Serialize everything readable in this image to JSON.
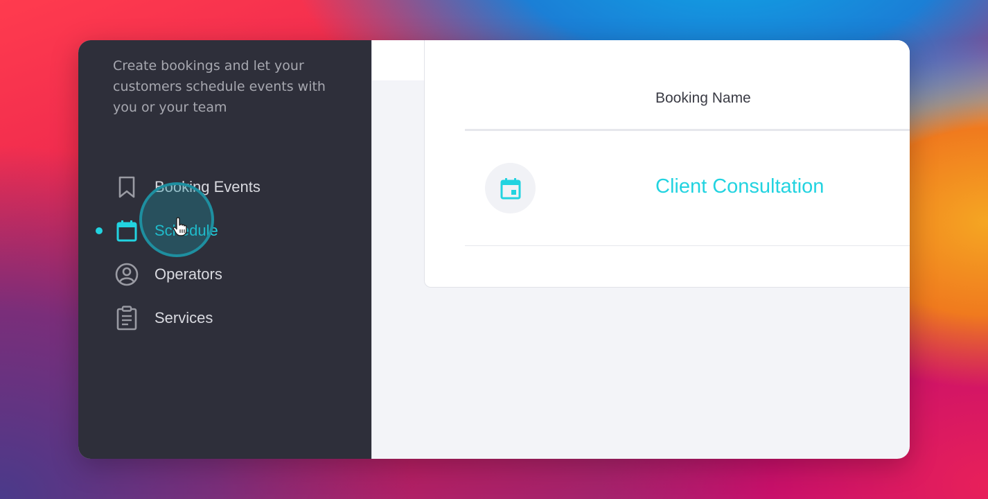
{
  "sidebar": {
    "description": "Create bookings and let your customers schedule events with you or your team",
    "items": [
      {
        "label": "Booking Events",
        "icon": "bookmark-icon",
        "active": false
      },
      {
        "label": "Schedule",
        "icon": "calendar-icon",
        "active": true
      },
      {
        "label": "Operators",
        "icon": "user-circle-icon",
        "active": false
      },
      {
        "label": "Services",
        "icon": "clipboard-icon",
        "active": false
      }
    ]
  },
  "table": {
    "header": "Booking Name",
    "rows": [
      {
        "name": "Client Consultation",
        "icon": "calendar-icon"
      }
    ]
  },
  "colors": {
    "accent": "#22d3e0",
    "sidebar_bg": "#2e2f3a",
    "sidebar_text": "#d9dae0",
    "sidebar_muted": "#a7a8b0"
  }
}
